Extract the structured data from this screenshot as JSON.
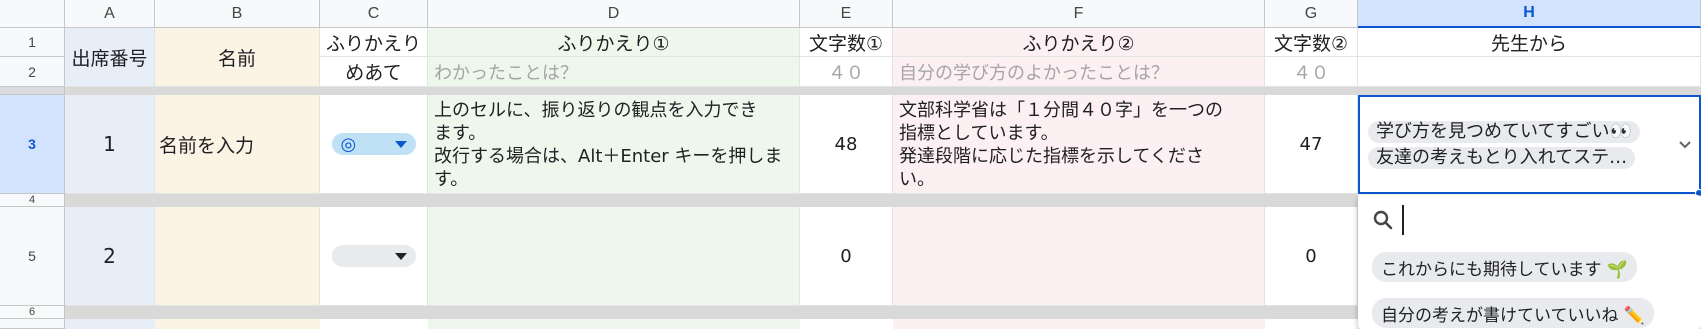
{
  "columns": [
    "A",
    "B",
    "C",
    "D",
    "E",
    "F",
    "G",
    "H"
  ],
  "rows": [
    "1",
    "2",
    "3",
    "4",
    "5",
    "6"
  ],
  "header": {
    "attendance_no": "出席番号",
    "name": "名前",
    "furikaeri": "ふりかえり",
    "meate": "めあて",
    "reflection1": "ふりかえり①",
    "reflection1_hint": "わかったことは？",
    "count1": "文字数①",
    "count1_hint": "４０",
    "reflection2": "ふりかえり②",
    "reflection2_hint": "自分の学び方のよかったことは？",
    "count2": "文字数②",
    "count2_hint": "４０",
    "teacher": "先生から"
  },
  "records": [
    {
      "no": "1",
      "name": "名前を入力",
      "mark": "◎",
      "reflection1": [
        "上のセルに、振り返りの観点を入力でき",
        "ます。",
        "改行する場合は、Alt＋Enter キーを押しま",
        "す。"
      ],
      "count1": "48",
      "reflection2": [
        "文部科学省は「１分間４０字」を一つの",
        "指標としています。",
        "発達段階に応じた指標を示してくださ",
        "い。"
      ],
      "count2": "47",
      "teacher_tags": [
        "学び方を見つめていてすごい👀",
        "友達の考えもとり入れてステ…"
      ]
    },
    {
      "no": "2",
      "name": "",
      "mark": "",
      "count1": "0",
      "count2": "0"
    }
  ],
  "dropdown": {
    "search_value": "",
    "options": [
      "これからにも期待しています 🌱",
      "自分の考えが書けていていいね ✏️"
    ]
  },
  "colors": {
    "col_a_bg": "#e8eef8",
    "col_b_bg": "#fbf3e4",
    "col_d_bg": "#eef7ec",
    "col_f_bg": "#fdf0f3",
    "selected_header": "#d3e3fd",
    "accent": "#0b57d0",
    "chip_selected": "#bfe1f6"
  }
}
